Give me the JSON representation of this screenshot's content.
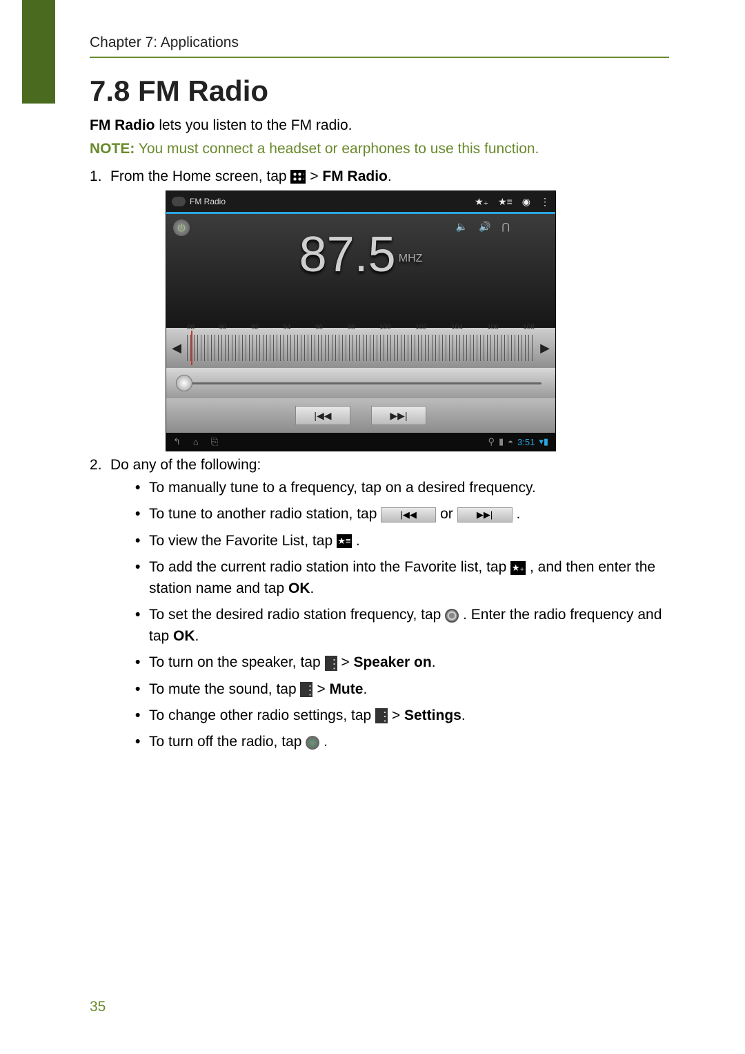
{
  "chapter": "Chapter 7: Applications",
  "heading": "7.8 FM Radio",
  "intro_bold": "FM Radio",
  "intro_rest": " lets you listen to the FM radio.",
  "note_label": "NOTE:",
  "note_text": " You must connect a headset or earphones to use this function.",
  "step1_a": "From the Home screen, tap ",
  "step1_b": " > ",
  "step1_c": "FM Radio",
  "step1_d": ".",
  "step2": "Do any of the following:",
  "bullets": {
    "b1": "To manually tune to a frequency, tap on a desired frequency.",
    "b2_a": "To tune to another radio station, tap ",
    "b2_b": " or ",
    "b2_c": ".",
    "b3_a": "To view the Favorite List, tap ",
    "b3_b": ".",
    "b4_a": "To add the current radio station into the Favorite list, tap ",
    "b4_b": ", and then enter the station name and tap ",
    "b4_c": "OK",
    "b4_d": ".",
    "b5_a": "To set the desired radio station frequency, tap ",
    "b5_b": ". Enter the radio frequency and tap ",
    "b5_c": "OK",
    "b5_d": ".",
    "b6_a": "To turn on the speaker, tap ",
    "b6_b": " > ",
    "b6_c": "Speaker on",
    "b6_d": ".",
    "b7_a": "To mute the sound, tap ",
    "b7_b": " > ",
    "b7_c": "Mute",
    "b7_d": ".",
    "b8_a": "To change other radio settings, tap ",
    "b8_b": " > ",
    "b8_c": "Settings",
    "b8_d": ".",
    "b9_a": "To turn off the radio, tap ",
    "b9_b": "."
  },
  "screenshot": {
    "title": "FM Radio",
    "frequency": "87.5",
    "unit": "MHZ",
    "ticks": [
      "88",
      "90",
      "92",
      "94",
      "96",
      "98",
      "100",
      "102",
      "104",
      "106",
      "108"
    ],
    "prev_btn": "|◀◀",
    "next_btn": "▶▶|",
    "nav": {
      "back": "↰",
      "home": "⌂",
      "recent": "⎘"
    },
    "status_time": "3:51",
    "top_icons": {
      "star_add": "★₊",
      "star_list": "★≡",
      "record": "◉",
      "menu": "⋮"
    },
    "audio_icons": "🔈 🔊 ⋂"
  },
  "page_number": "35",
  "inline": {
    "seek_prev": "|◀◀",
    "seek_next": "▶▶|",
    "star_list": "★≡",
    "star_add": "★₊",
    "power": "⏻",
    "menu": "⋮"
  }
}
